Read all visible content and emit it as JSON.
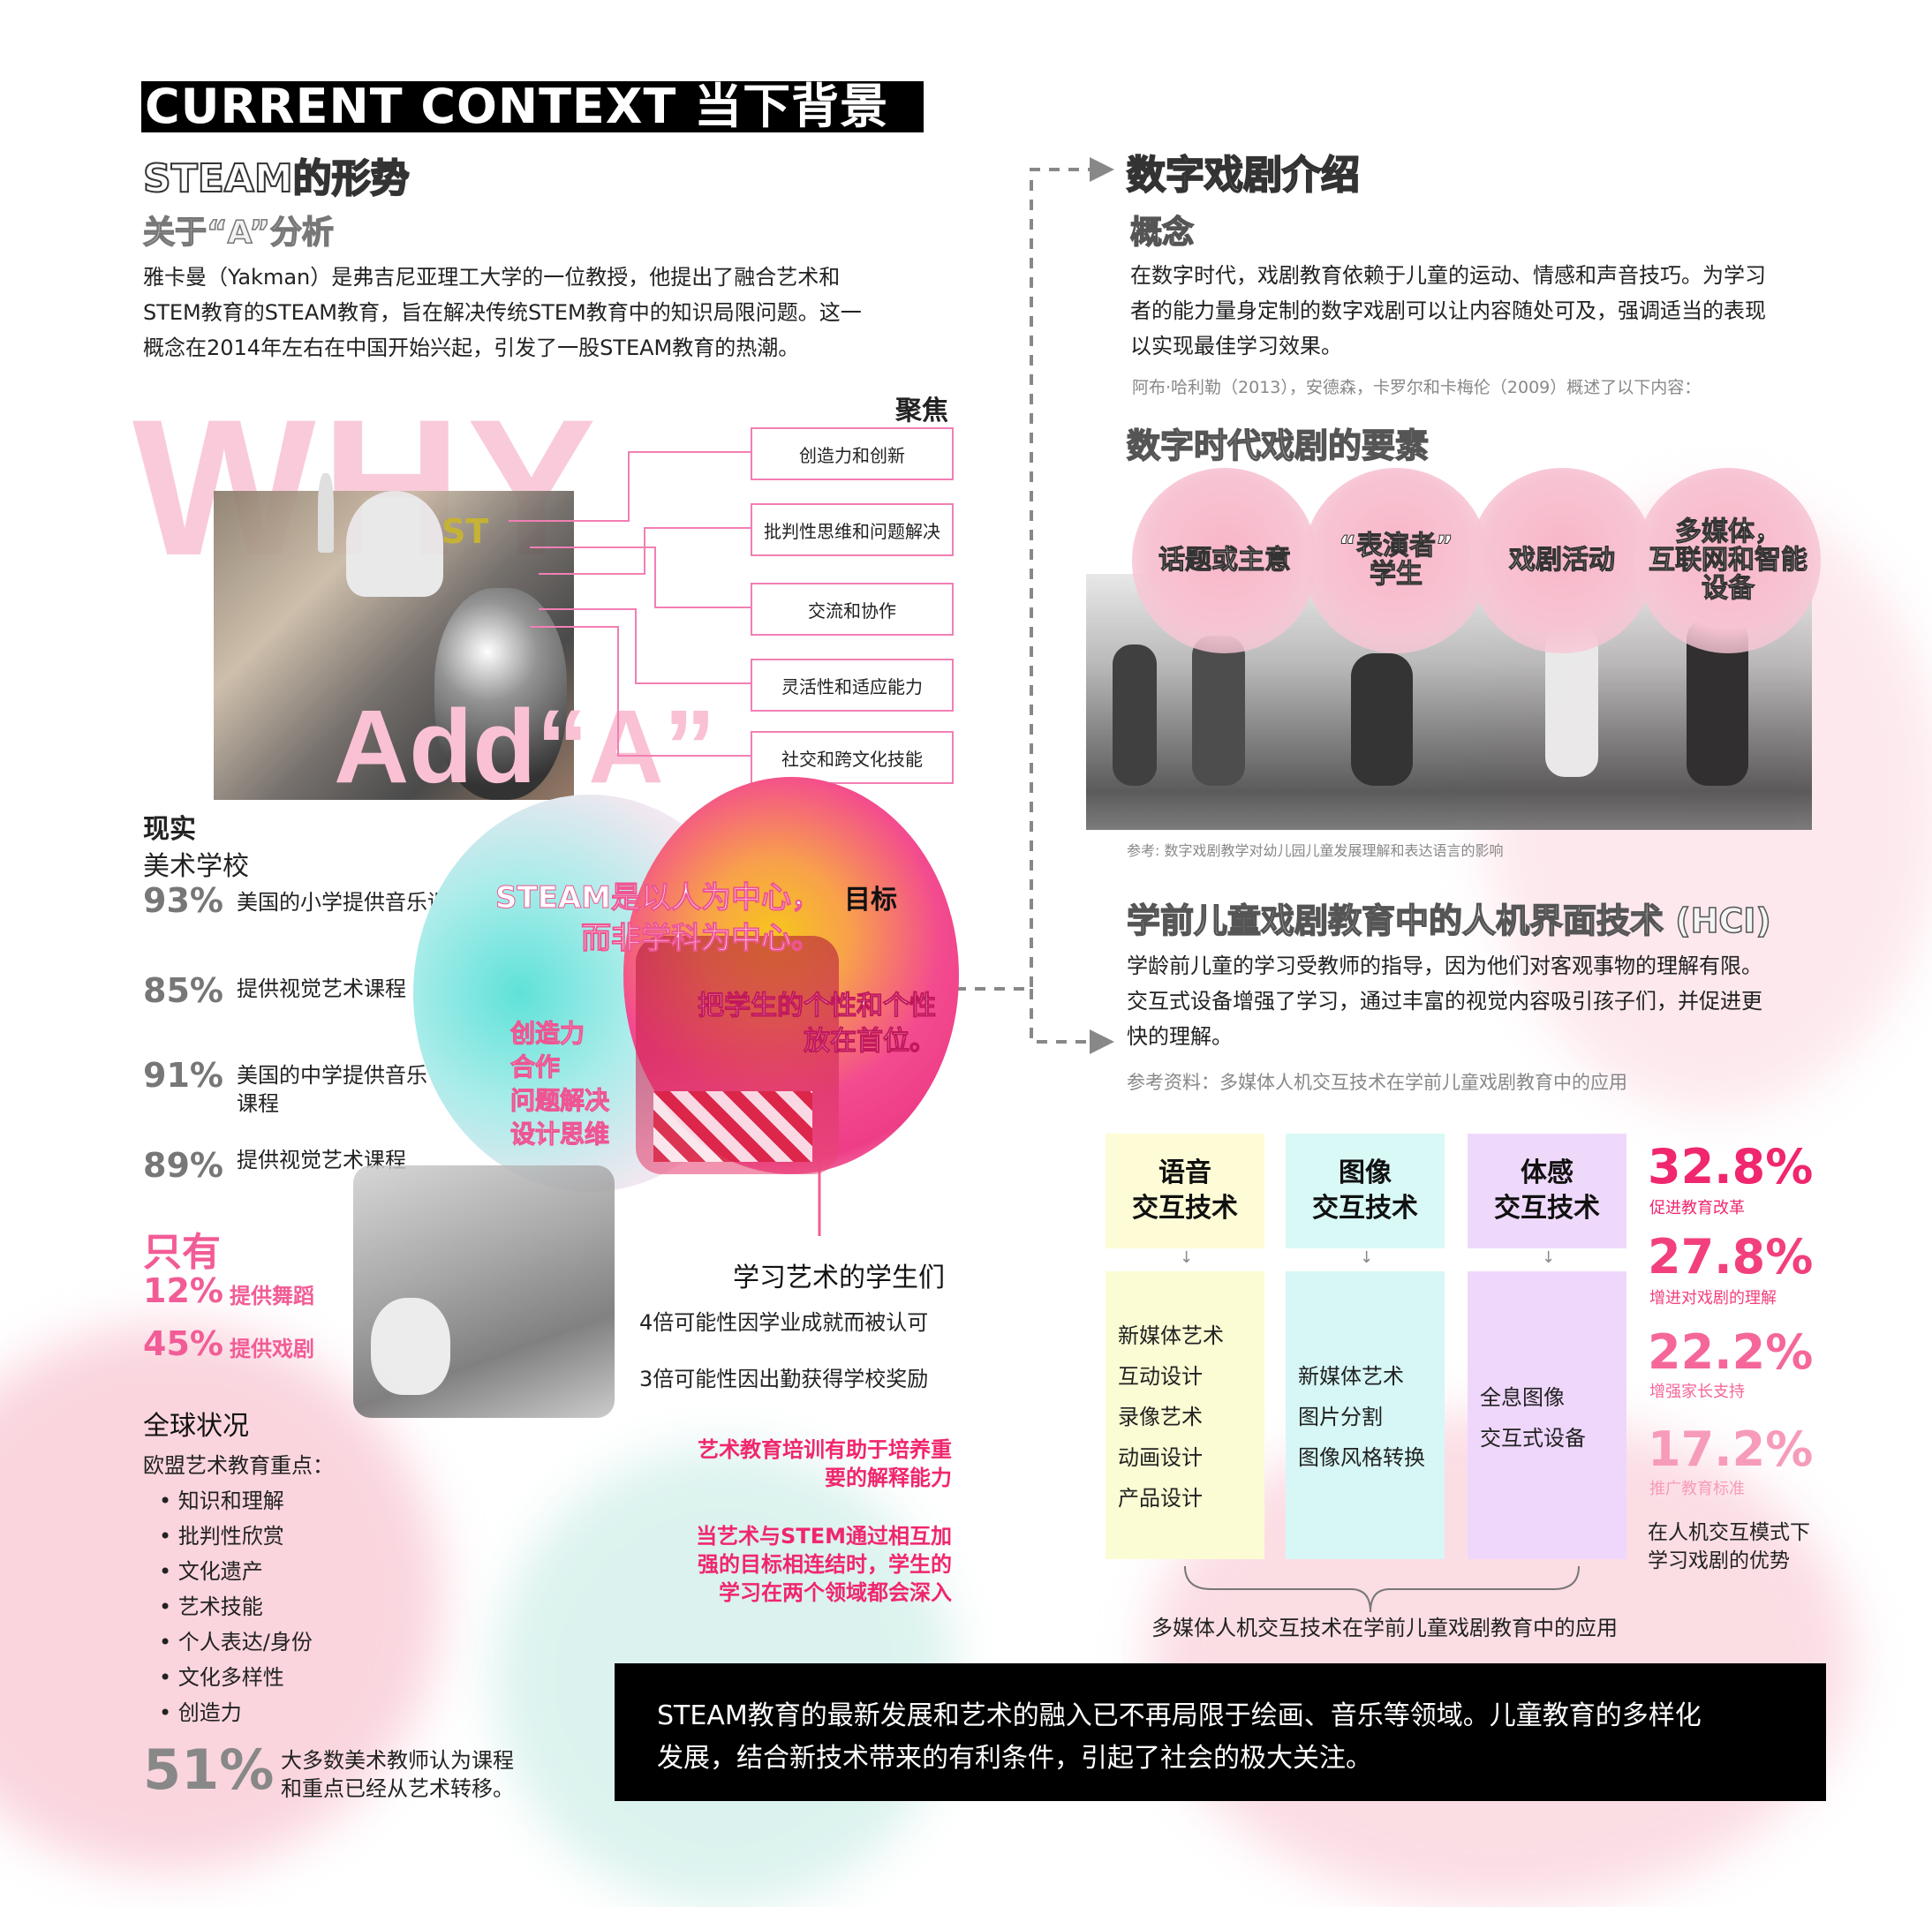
{
  "header": {
    "title": "CURRENT CONTEXT  当下背景"
  },
  "left": {
    "steam_title": "STEAM的形势",
    "analysis_title": "关于“A”分析",
    "intro_lines": [
      "雅卡曼（Yakman）是弗吉尼亚理工大学的一位教授，他提出了融合艺术和",
      "STEM教育的STEAM教育，旨在解决传统STEM教育中的知识局限问题。这一",
      "概念在2014年左右在中国开始兴起，引发了一股STEAM教育的热潮。"
    ],
    "why_text": "WHY",
    "add_a_text": "Add“A”",
    "focus_label": "聚焦",
    "focus_items": [
      "创造力和创新",
      "批判性思维和问题解决",
      "交流和协作",
      "灵活性和适应能力",
      "社交和跨文化技能"
    ],
    "reality_label": "现实",
    "art_school_label": "美术学校",
    "stats": [
      {
        "value": "93%",
        "text": "美国的小学提供音乐课程"
      },
      {
        "value": "85%",
        "text": "提供视觉艺术课程"
      },
      {
        "value": "91%",
        "text": "美国的中学提供音乐课程"
      },
      {
        "value": "89%",
        "text": "提供视觉艺术课程"
      }
    ],
    "only_label": "只有",
    "only_stats": [
      {
        "value": "12%",
        "text": "提供舞蹈"
      },
      {
        "value": "45%",
        "text": "提供戏剧"
      }
    ],
    "global_label": "全球状况",
    "eu_label": "欧盟艺术教育重点：",
    "eu_bullets": [
      "知识和理解",
      "批判性欣赏",
      "文化遗产",
      "艺术技能",
      "个人表达/身份",
      "文化多样性",
      "创造力"
    ],
    "final_value": "51%",
    "final_text_lines": [
      "大多数美术教师认为课程",
      "和重点已经从艺术转移。"
    ]
  },
  "center": {
    "goal_label": "目标",
    "steam_lines": [
      "STEAM是以人为中心，",
      "而非学科为中心。"
    ],
    "student_first_lines": [
      "把学生的个性和个性",
      "放在首位。"
    ],
    "skills": [
      "创造力",
      "合作",
      "问题解决",
      "设计思维"
    ],
    "students_title": "学习艺术的学生们",
    "student_facts": [
      "4倍可能性因学业成就而被认可",
      "3倍可能性因出勤获得学校奖励"
    ],
    "pink_note1": [
      "艺术教育培训有助于培养重",
      "要的解释能力"
    ],
    "pink_note2": [
      "当艺术与STEM通过相互加",
      "强的目标相连结时，学生的",
      "学习在两个领域都会深入"
    ]
  },
  "right": {
    "digital_title": "数字戏剧介绍",
    "concept_label": "概念",
    "concept_lines": [
      "在数字时代，戏剧教育依赖于儿童的运动、情感和声音技巧。为学习",
      "者的能力量身定制的数字戏剧可以让内容随处可及，强调适当的表现",
      "以实现最佳学习效果。"
    ],
    "citation": "阿布·哈利勒（2013），安德森，卡罗尔和卡梅伦（2009）概述了以下内容：",
    "elements_title": "数字时代戏剧的要素",
    "bubbles": [
      {
        "lines": [
          "话题或主意"
        ]
      },
      {
        "lines": [
          "“表演者”",
          "学生"
        ]
      },
      {
        "lines": [
          "戏剧活动"
        ]
      },
      {
        "lines": [
          "多媒体，",
          "互联网和智能",
          "设备"
        ]
      }
    ],
    "photo_ref": "参考: 数字戏剧教学对幼儿园儿童发展理解和表达语言的影响",
    "hci_title": "学前儿童戏剧教育中的人机界面技术 (HCI)",
    "hci_lines": [
      "学龄前儿童的学习受教师的指导，因为他们对客观事物的理解有限。",
      "交互式设备增强了学习，通过丰富的视觉内容吸引孩子们，并促进更",
      "快的理解。"
    ],
    "hci_ref": "参考资料：多媒体人机交互技术在学前儿童戏剧教育中的应用",
    "tech_columns": [
      {
        "head": [
          "语音",
          "交互技术"
        ],
        "items": [
          "新媒体艺术",
          "互动设计",
          "录像艺术",
          "动画设计",
          "产品设计"
        ],
        "head_color": "#fdfcd6",
        "body_color": "#fbfcd4"
      },
      {
        "head": [
          "图像",
          "交互技术"
        ],
        "items": [
          "新媒体艺术",
          "图片分割",
          "图像风格转换"
        ],
        "head_color": "#d9f9f6",
        "body_color": "#d6f7f5"
      },
      {
        "head": [
          "体感",
          "交互技术"
        ],
        "items": [
          "全息图像",
          "交互式设备"
        ],
        "head_color": "#efd9fa",
        "body_color": "#efd7fb"
      }
    ],
    "tech_caption": "多媒体人机交互技术在学前儿童戏剧教育中的应用",
    "percentages": [
      {
        "value": "32.8%",
        "label": "促进教育改革",
        "color": "#f0266e"
      },
      {
        "value": "27.8%",
        "label": "增进对戏剧的理解",
        "color": "#f23f7d"
      },
      {
        "value": "22.2%",
        "label": "增强家长支持",
        "color": "#f5679a"
      },
      {
        "value": "17.2%",
        "label": "推广教育标准",
        "color": "#f79bba"
      }
    ],
    "advantage_lines": [
      "在人机交互模式下",
      "学习戏剧的优势"
    ]
  },
  "footer": {
    "lines": [
      "STEAM教育的最新发展和艺术的融入已不再局限于绘画、音乐等领域。儿童教育的多样化",
      "发展，结合新技术带来的有利条件，引起了社会的极大关注。"
    ]
  }
}
